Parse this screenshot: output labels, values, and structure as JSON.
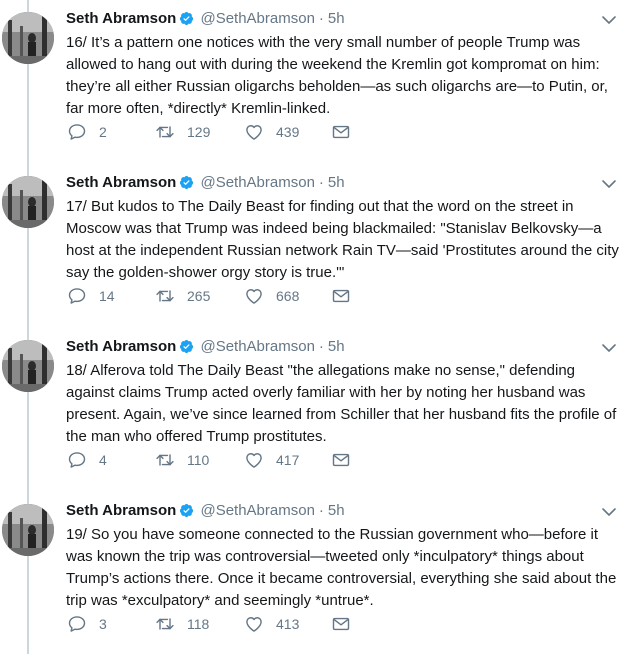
{
  "tweets": [
    {
      "name": "Seth Abramson",
      "handle": "@SethAbramson",
      "time": "5h",
      "text": "16/ It’s a pattern one notices with the very small number of people Trump was allowed to hang out with during the weekend the Kremlin got kompromat on him: they’re all either Russian oligarchs beholden—as such oligarchs are—to Putin, or, far more often, *directly* Kremlin-linked.",
      "replies": "2",
      "retweets": "129",
      "likes": "439"
    },
    {
      "name": "Seth Abramson",
      "handle": "@SethAbramson",
      "time": "5h",
      "text": "17/ But kudos to The Daily Beast for finding out that the word on the street in Moscow was that Trump was indeed being blackmailed: \"Stanislav Belkovsky—a host at the independent Russian network Rain TV—said 'Prostitutes around the city say the golden-shower orgy story is true.'\"",
      "replies": "14",
      "retweets": "265",
      "likes": "668"
    },
    {
      "name": "Seth Abramson",
      "handle": "@SethAbramson",
      "time": "5h",
      "text": "18/ Alferova told The Daily Beast \"the allegations make no sense,\" defending against claims Trump acted overly familiar with her by noting her husband was present. Again, we’ve since learned from Schiller that her husband fits the profile of the man who offered Trump prostitutes.",
      "replies": "4",
      "retweets": "110",
      "likes": "417"
    },
    {
      "name": "Seth Abramson",
      "handle": "@SethAbramson",
      "time": "5h",
      "text": "19/ So you have someone connected to the Russian government who—before it was known the trip was controversial—tweeted only *inculpatory* things about Trump’s actions there. Once it became controversial, everything she said about the trip was *exculpatory* and seemingly *untrue*.",
      "replies": "3",
      "retweets": "118",
      "likes": "413"
    }
  ],
  "colors": {
    "text": "#14171a",
    "muted": "#657786",
    "verified": "#1da1f2",
    "thread": "#ccd6dd"
  },
  "icons": [
    "verified-badge-icon",
    "caret-down-icon",
    "reply-icon",
    "retweet-icon",
    "like-icon",
    "direct-message-icon"
  ]
}
